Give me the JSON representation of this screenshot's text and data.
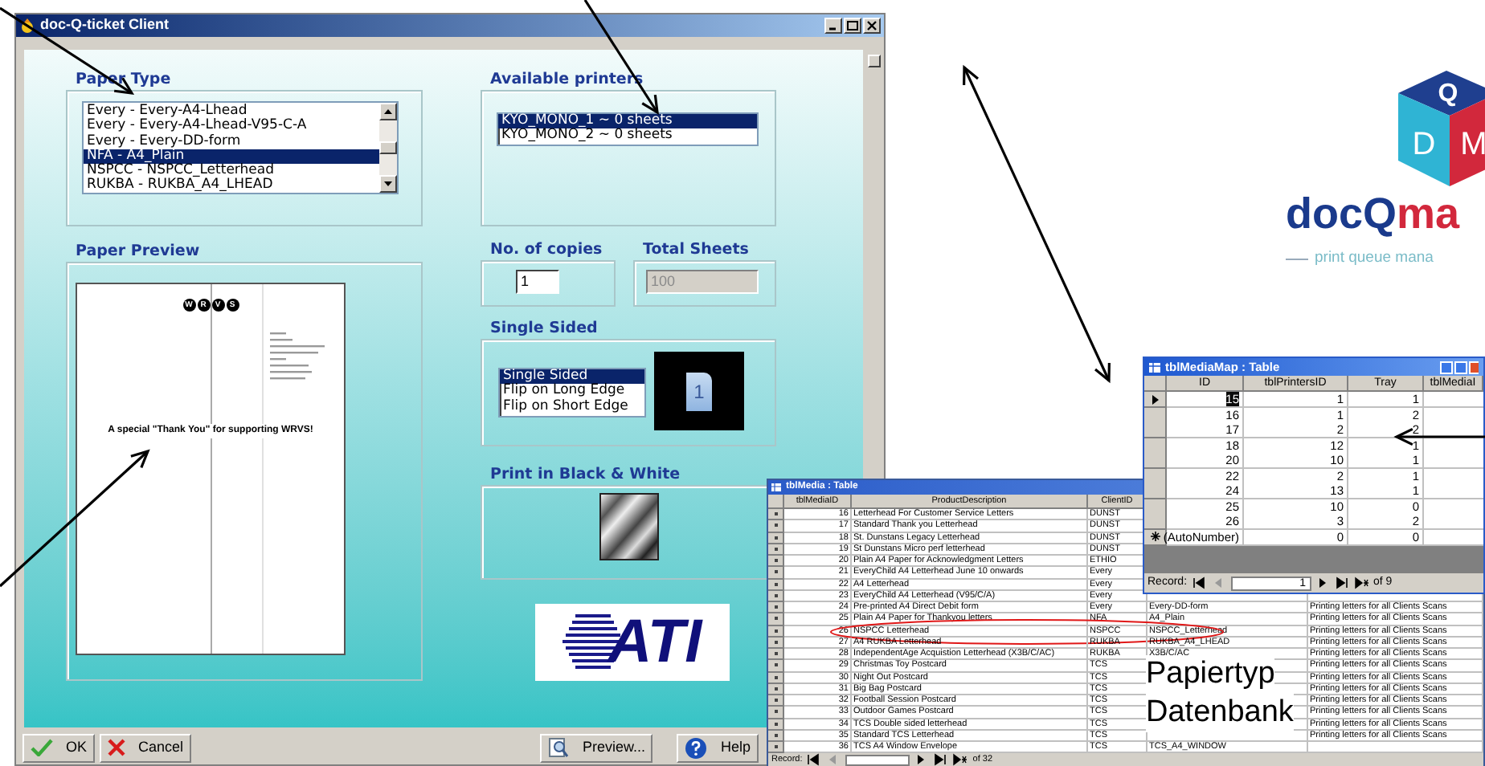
{
  "main_window": {
    "title": "doc-Q-ticket Client",
    "paper_type": {
      "label": "Paper Type",
      "items": [
        {
          "text": "Every - Every-A4-Lhead",
          "selected": false
        },
        {
          "text": "Every - Every-A4-Lhead-V95-C-A",
          "selected": false
        },
        {
          "text": "Every - Every-DD-form",
          "selected": false
        },
        {
          "text": "NFA - A4_Plain",
          "selected": true
        },
        {
          "text": "NSPCC - NSPCC_Letterhead",
          "selected": false
        },
        {
          "text": "RUKBA - RUKBA_A4_LHEAD",
          "selected": false
        }
      ]
    },
    "available_printers": {
      "label": "Available printers",
      "items": [
        {
          "text": "KYO_MONO_1 ~ 0 sheets",
          "selected": true
        },
        {
          "text": "KYO_MONO_2 ~ 0 sheets",
          "selected": false
        }
      ]
    },
    "paper_preview": {
      "label": "Paper Preview",
      "logo_letters": [
        "W",
        "R",
        "V",
        "S"
      ],
      "message": "A special \"Thank You\" for supporting WRVS!"
    },
    "copies": {
      "label": "No. of copies",
      "value": "1"
    },
    "total_sheets": {
      "label": "Total Sheets",
      "value": "100",
      "disabled": true
    },
    "sides": {
      "label": "Single Sided",
      "page_number": "1",
      "items": [
        {
          "text": "Single Sided",
          "selected": true
        },
        {
          "text": "Flip on Long Edge",
          "selected": false
        },
        {
          "text": "Flip on Short Edge",
          "selected": false
        }
      ]
    },
    "black_white": {
      "label": "Print in Black & White"
    },
    "brand_logo": "ATI",
    "buttons": [
      {
        "label": "OK",
        "kind": "ok"
      },
      {
        "label": "Cancel",
        "kind": "cancel"
      },
      {
        "label": "Preview...",
        "kind": "preview"
      },
      {
        "label": "Help",
        "kind": "help"
      }
    ]
  },
  "product_logo": {
    "cube_letters": [
      "Q",
      "D",
      "M"
    ],
    "name_part_1": "docQ",
    "name_part_2": "ma",
    "tagline": "print queue mana"
  },
  "media_table": {
    "title": "tblMedia : Table",
    "columns": [
      "tblMediaID",
      "ProductDescription",
      "ClientID"
    ],
    "rows": [
      {
        "id": "16",
        "description": "Letterhead For Customer Service Letters",
        "client": "DUNST",
        "circled": false
      },
      {
        "id": "17",
        "description": "Standard Thank you Letterhead",
        "client": "DUNST",
        "circled": false
      },
      {
        "id": "18",
        "description": "St. Dunstans Legacy Letterhead",
        "client": "DUNST",
        "circled": false
      },
      {
        "id": "19",
        "description": "St Dunstans Micro perf letterhead",
        "client": "DUNST",
        "circled": false
      },
      {
        "id": "20",
        "description": "Plain A4 Paper for Acknowledgment Letters",
        "client": "ETHIO",
        "circled": false
      },
      {
        "id": "21",
        "description": "EveryChild A4 Letterhead June 10 onwards",
        "client": "Every",
        "circled": false
      },
      {
        "id": "22",
        "description": "A4 Letterhead",
        "client": "Every",
        "circled": false
      },
      {
        "id": "23",
        "description": "EveryChild A4 Letterhead (V95/C/A)",
        "client": "Every",
        "circled": false
      },
      {
        "id": "24",
        "description": "Pre-printed A4 Direct Debit form",
        "client": "Every",
        "column_4": "Every-DD-form",
        "column_5": "Printing letters for all Clients Scans",
        "circled": false
      },
      {
        "id": "25",
        "description": "Plain A4 Paper for Thankyou letters",
        "client": "NFA",
        "column_4": "A4_Plain",
        "column_5": "Printing letters for all Clients Scans",
        "circled": false
      },
      {
        "id": "26",
        "description": "NSPCC Letterhead",
        "client": "NSPCC",
        "column_4": "NSPCC_Letterhead",
        "column_5": "Printing letters for all Clients Scans",
        "circled": true
      },
      {
        "id": "27",
        "description": "A4 RUKBA Letterhead",
        "client": "RUKBA",
        "column_4": "RUKBA_A4_LHEAD",
        "column_5": "Printing letters for all Clients Scans",
        "circled": false
      },
      {
        "id": "28",
        "description": "IndependentAge Acquistion Letterhead (X3B/C/AC)",
        "client": "RUKBA",
        "column_4": "X3B/C/AC",
        "column_5": "Printing letters for all Clients Scans",
        "circled": false
      },
      {
        "id": "29",
        "description": "Christmas Toy Postcard",
        "client": "TCS",
        "column_5": "Printing letters for all Clients Scans",
        "circled": false
      },
      {
        "id": "30",
        "description": "Night Out Postcard",
        "client": "TCS",
        "column_5": "Printing letters for all Clients Scans",
        "circled": false
      },
      {
        "id": "31",
        "description": "Big Bag Postcard",
        "client": "TCS",
        "column_5": "Printing letters for all Clients Scans",
        "circled": false
      },
      {
        "id": "32",
        "description": "Football Session Postcard",
        "client": "TCS",
        "column_5": "Printing letters for all Clients Scans",
        "circled": false
      },
      {
        "id": "33",
        "description": "Outdoor Games Postcard",
        "client": "TCS",
        "column_5": "Printing letters for all Clients Scans",
        "circled": false
      },
      {
        "id": "34",
        "description": "TCS Double sided letterhead",
        "client": "TCS",
        "column_5": "Printing letters for all Clients Scans",
        "circled": false
      },
      {
        "id": "35",
        "description": "Standard TCS Letterhead",
        "client": "TCS",
        "column_5": "Printing letters for all Clients Scans",
        "circled": false
      },
      {
        "id": "36",
        "description": "TCS A4 Window Envelope",
        "client": "TCS",
        "column_4": "TCS_A4_WINDOW",
        "circled": false
      }
    ],
    "record_label": "Record:",
    "record_total": "of 32"
  },
  "media_map_table": {
    "title": "tblMediaMap : Table",
    "columns": [
      "ID",
      "tblPrintersID",
      "Tray",
      "tblMediaI"
    ],
    "rows": [
      {
        "kind": "record",
        "id": "15",
        "printer": "1",
        "tray": "1",
        "selected": true
      },
      {
        "kind": "record",
        "id": "16",
        "printer": "1",
        "tray": "2",
        "selected": false
      },
      {
        "kind": "record",
        "id": "17",
        "printer": "2",
        "tray": "2",
        "selected": false
      },
      {
        "kind": "record",
        "id": "18",
        "printer": "12",
        "tray": "1",
        "selected": false
      },
      {
        "kind": "record",
        "id": "20",
        "printer": "10",
        "tray": "1",
        "selected": false
      },
      {
        "kind": "record",
        "id": "22",
        "printer": "2",
        "tray": "1",
        "selected": false
      },
      {
        "kind": "record",
        "id": "24",
        "printer": "13",
        "tray": "1",
        "selected": false
      },
      {
        "kind": "record",
        "id": "25",
        "printer": "10",
        "tray": "0",
        "selected": false
      },
      {
        "kind": "record",
        "id": "26",
        "printer": "3",
        "tray": "2",
        "selected": false
      },
      {
        "kind": "new",
        "id": "(AutoNumber)",
        "printer": "0",
        "tray": "0",
        "selected": false
      }
    ],
    "record_label": "Record:",
    "record_value": "1",
    "record_total": "of 9"
  },
  "caption": [
    "Papiertyp",
    "Datenbank"
  ]
}
